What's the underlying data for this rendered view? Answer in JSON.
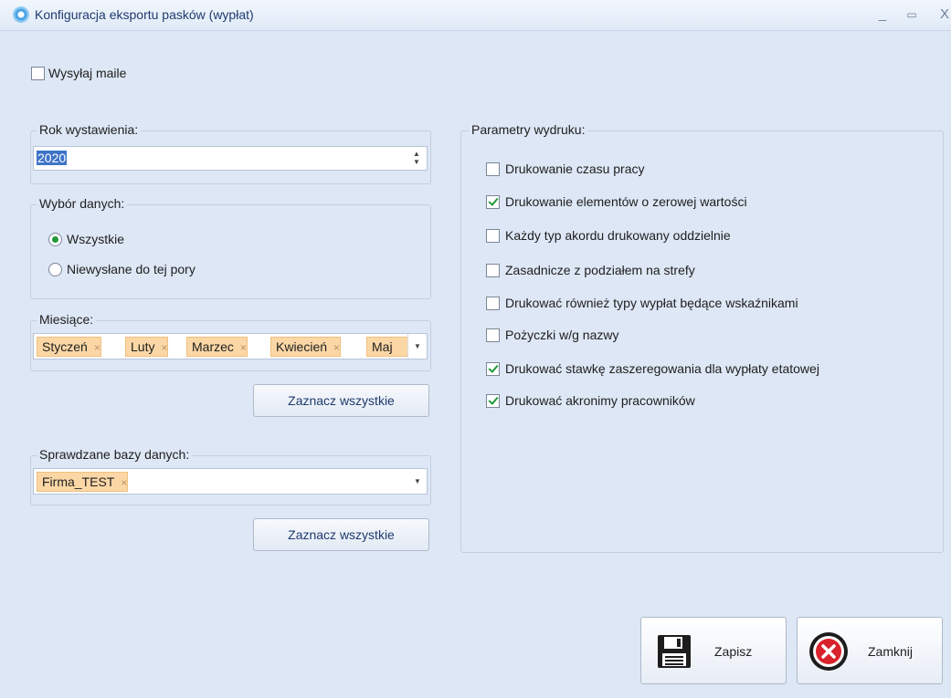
{
  "window": {
    "title": "Konfiguracja eksportu pasków (wypłat)",
    "minimize": "_",
    "maximize": "▭",
    "close": "X"
  },
  "send_mail": {
    "label": "Wysyłaj maile",
    "checked": false
  },
  "year": {
    "legend": "Rok wystawienia:",
    "value": "2020",
    "spin_up": "▲",
    "spin_down": "▼"
  },
  "data_choice": {
    "legend": "Wybór danych:",
    "options": [
      {
        "label": "Wszystkie",
        "selected": true
      },
      {
        "label": "Niewysłane do tej pory",
        "selected": false
      }
    ]
  },
  "months": {
    "legend": "Miesiące:",
    "tags": [
      "Styczeń",
      "Luty",
      "Marzec",
      "Kwiecień",
      "Maj"
    ],
    "tag_remove": "×",
    "dropdown_arrow": "▼",
    "select_all": "Zaznacz wszystkie"
  },
  "databases": {
    "legend": "Sprawdzane bazy danych:",
    "tags": [
      "Firma_TEST"
    ],
    "tag_remove": "×",
    "dropdown_arrow": "▼",
    "select_all": "Zaznacz wszystkie"
  },
  "print_params": {
    "legend": "Parametry wydruku:",
    "options": [
      {
        "label": "Drukowanie czasu pracy",
        "checked": false
      },
      {
        "label": "Drukowanie elementów o zerowej wartości",
        "checked": true
      },
      {
        "label": "Każdy typ akordu drukowany oddzielnie",
        "checked": false
      },
      {
        "label": "Zasadnicze z podziałem na strefy",
        "checked": false
      },
      {
        "label": "Drukować również typy wypłat będące wskaźnikami",
        "checked": false
      },
      {
        "label": "Pożyczki w/g nazwy",
        "checked": false
      },
      {
        "label": "Drukować stawkę zaszeregowania dla wypłaty etatowej",
        "checked": true
      },
      {
        "label": "Drukować akronimy pracowników",
        "checked": true
      }
    ]
  },
  "buttons": {
    "save": "Zapisz",
    "close": "Zamknij"
  },
  "colors": {
    "accent_check": "#1f9a3a",
    "tag_bg": "#fbd7a6",
    "close_icon": "#d9232c",
    "window_bg": "#dde7f5"
  }
}
